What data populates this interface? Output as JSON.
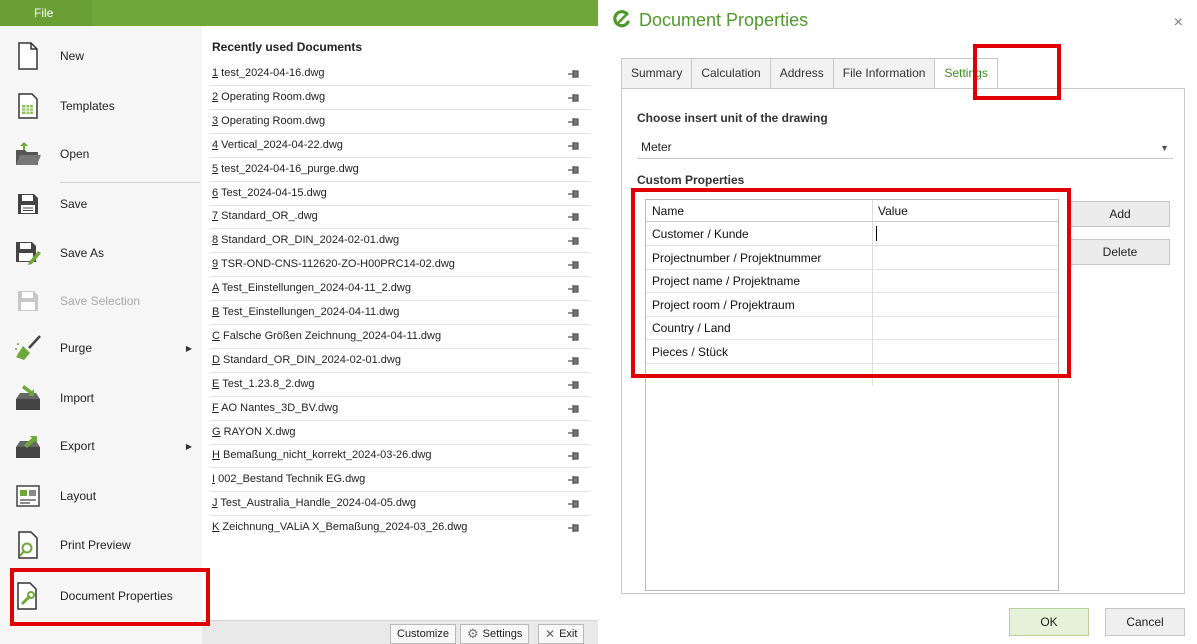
{
  "file_menu": {
    "tab_label": "File",
    "items": [
      {
        "label": "New",
        "icon": "new-document-icon",
        "disabled": false,
        "submenu": false
      },
      {
        "label": "Templates",
        "icon": "templates-icon",
        "disabled": false,
        "submenu": false
      },
      {
        "label": "Open",
        "icon": "open-folder-icon",
        "disabled": false,
        "submenu": false
      },
      {
        "label": "Save",
        "icon": "save-icon",
        "disabled": false,
        "submenu": false
      },
      {
        "label": "Save As",
        "icon": "save-as-icon",
        "disabled": false,
        "submenu": false
      },
      {
        "label": "Save Selection",
        "icon": "save-selection-icon",
        "disabled": true,
        "submenu": false
      },
      {
        "label": "Purge",
        "icon": "purge-broom-icon",
        "disabled": false,
        "submenu": true
      },
      {
        "label": "Import",
        "icon": "import-icon",
        "disabled": false,
        "submenu": false
      },
      {
        "label": "Export",
        "icon": "export-icon",
        "disabled": false,
        "submenu": true
      },
      {
        "label": "Layout",
        "icon": "layout-icon",
        "disabled": false,
        "submenu": false
      },
      {
        "label": "Print Preview",
        "icon": "print-preview-icon",
        "disabled": false,
        "submenu": false
      },
      {
        "label": "Document Properties",
        "icon": "document-properties-icon",
        "disabled": false,
        "submenu": false
      }
    ]
  },
  "recent": {
    "title": "Recently used Documents",
    "items": [
      {
        "key": "1",
        "name": " test_2024-04-16.dwg"
      },
      {
        "key": "2",
        "name": " Operating Room.dwg"
      },
      {
        "key": "3",
        "name": " Operating Room.dwg"
      },
      {
        "key": "4",
        "name": " Vertical_2024-04-22.dwg"
      },
      {
        "key": "5",
        "name": " test_2024-04-16_purge.dwg"
      },
      {
        "key": "6",
        "name": " Test_2024-04-15.dwg"
      },
      {
        "key": "7",
        "name": " Standard_OR_.dwg"
      },
      {
        "key": "8",
        "name": " Standard_OR_DIN_2024-02-01.dwg"
      },
      {
        "key": "9",
        "name": " TSR-OND-CNS-112620-ZO-H00PRC14-02.dwg"
      },
      {
        "key": "A",
        "name": " Test_Einstellungen_2024-04-11_2.dwg"
      },
      {
        "key": "B",
        "name": " Test_Einstellungen_2024-04-11.dwg"
      },
      {
        "key": "C",
        "name": " Falsche Größen Zeichnung_2024-04-11.dwg"
      },
      {
        "key": "D",
        "name": " Standard_OR_DIN_2024-02-01.dwg"
      },
      {
        "key": "E",
        "name": " Test_1.23.8_2.dwg"
      },
      {
        "key": "F",
        "name": " AO Nantes_3D_BV.dwg"
      },
      {
        "key": "G",
        "name": " RAYON X.dwg"
      },
      {
        "key": "H",
        "name": " Bemaßung_nicht_korrekt_2024-03-26.dwg"
      },
      {
        "key": "I",
        "name": " 002_Bestand Technik EG.dwg"
      },
      {
        "key": "J",
        "name": " Test_Australia_Handle_2024-04-05.dwg"
      },
      {
        "key": "K",
        "name": " Zeichnung_VALiA X_Bemaßung_2024-03_26.dwg"
      }
    ]
  },
  "bottom_bar": {
    "customize": "Customize",
    "settings": "Settings",
    "exit": "Exit"
  },
  "dialog": {
    "title": "Document Properties",
    "close": "×",
    "tabs": [
      "Summary",
      "Calculation",
      "Address",
      "File Information",
      "Settings"
    ],
    "active_tab": "Settings",
    "unit_label": "Choose insert unit of the drawing",
    "unit_value": "Meter",
    "custom_label": "Custom Properties",
    "table_headers": {
      "name": "Name",
      "value": "Value"
    },
    "rows": [
      {
        "name": "Customer / Kunde",
        "value": ""
      },
      {
        "name": "Projectnumber / Projektnummer",
        "value": ""
      },
      {
        "name": "Project name / Projektname",
        "value": ""
      },
      {
        "name": "Project room / Projektraum",
        "value": ""
      },
      {
        "name": "Country / Land",
        "value": ""
      },
      {
        "name": "Pieces / Stück",
        "value": ""
      }
    ],
    "add_button": "Add",
    "delete_button": "Delete",
    "ok_button": "OK",
    "cancel_button": "Cancel"
  },
  "colors": {
    "accent_green": "#6ea83a",
    "title_green": "#4e9a2a",
    "highlight_red": "#e00000"
  }
}
